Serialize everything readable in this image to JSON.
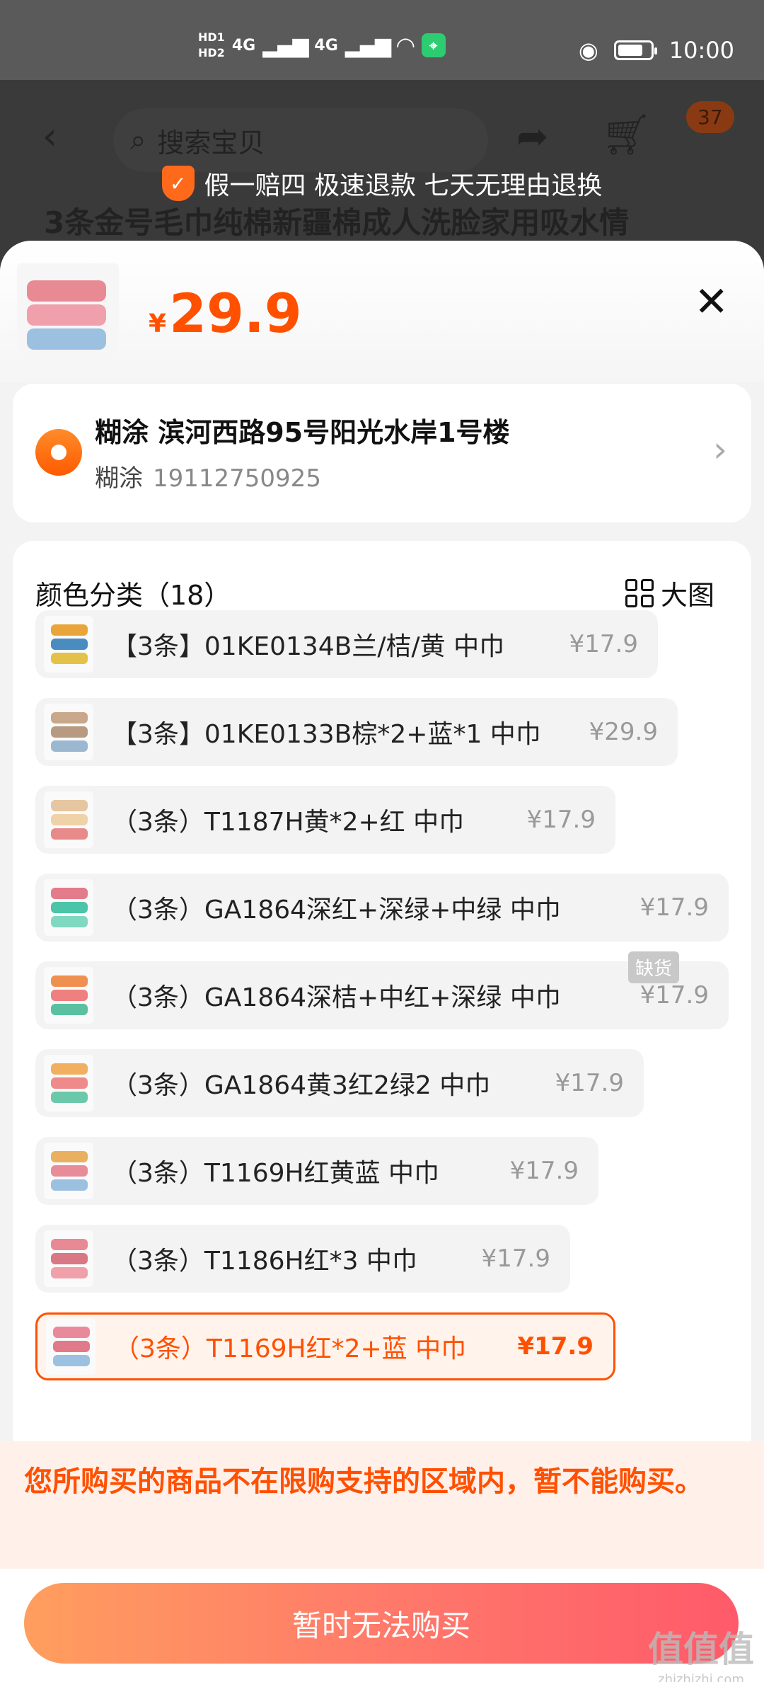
{
  "status_bar": {
    "time": "10:00",
    "network": "4G",
    "hd1": "HD1",
    "hd2": "HD2"
  },
  "header": {
    "search_placeholder": "搜索宝贝",
    "cart_count": "37",
    "promo": "假一赔四 极速退款 七天无理由退换",
    "product_title": "3条金号毛巾纯棉新疆棉成人洗脸家用吸水情"
  },
  "sheet": {
    "currency": "¥",
    "price": "29.9",
    "address": {
      "line1": "糊涂 滨河西路95号阳光水岸1号楼",
      "name": "糊涂",
      "phone": "19112750925"
    },
    "sku_title": "颜色分类（18）",
    "big_picture_label": "大图",
    "out_of_stock_label": "缺货",
    "options": [
      {
        "name": "【3条】01KE0134B兰/桔/黄 中巾",
        "price": "¥17.9",
        "colors": [
          "#e9a53a",
          "#4a8bc0",
          "#e4c24a"
        ]
      },
      {
        "name": "【3条】01KE0133B棕*2+蓝*1 中巾",
        "price": "¥29.9",
        "colors": [
          "#c8a78a",
          "#b89a80",
          "#9cb8d0"
        ]
      },
      {
        "name": "（3条）T1187H黄*2+红 中巾",
        "price": "¥17.9",
        "colors": [
          "#e6c6a0",
          "#f0d2a8",
          "#e88a8a"
        ]
      },
      {
        "name": "（3条）GA1864深红+深绿+中绿 中巾",
        "price": "¥17.9",
        "colors": [
          "#e37b8a",
          "#4cc4a8",
          "#7fd8c0"
        ]
      },
      {
        "name": "（3条）GA1864深桔+中红+深绿 中巾",
        "price": "¥17.9",
        "colors": [
          "#f09050",
          "#ef8080",
          "#5ac0a0"
        ]
      },
      {
        "name": "（3条）GA1864黄3红2绿2 中巾",
        "price": "¥17.9",
        "colors": [
          "#f0b060",
          "#ef8a8a",
          "#6cc8aa"
        ]
      },
      {
        "name": "（3条）T1169H红黄蓝 中巾",
        "price": "¥17.9",
        "colors": [
          "#e8b060",
          "#e88c9a",
          "#9cc0e0"
        ]
      },
      {
        "name": "（3条）T1186H红*3 中巾",
        "price": "¥17.9",
        "colors": [
          "#e88a94",
          "#d87884",
          "#f0a0aa"
        ]
      },
      {
        "name": "（3条）T1169H红*2+蓝 中巾",
        "price": "¥17.9",
        "colors": [
          "#e88a9a",
          "#e07a8a",
          "#9cc0e0"
        ]
      }
    ],
    "selected_option": 8,
    "warning": "您所购买的商品不在限购支持的区域内，暂不能购买。",
    "buy_button": "暂时无法购买"
  },
  "watermark": {
    "text": "值值值",
    "sub": "zhizhizhi.com"
  },
  "colors": {
    "accent": "#ff5000"
  }
}
